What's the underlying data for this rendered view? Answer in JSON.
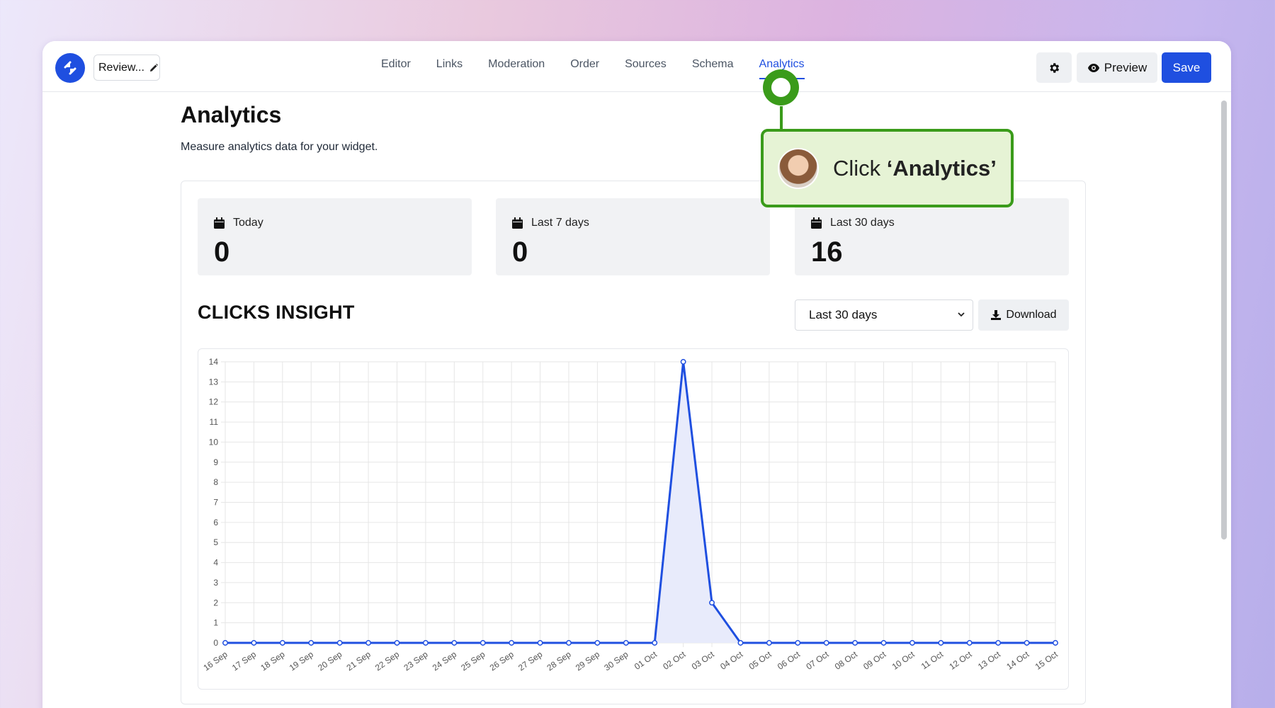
{
  "app": {
    "widget_name": "Review..."
  },
  "nav": {
    "tabs": [
      {
        "label": "Editor"
      },
      {
        "label": "Links"
      },
      {
        "label": "Moderation"
      },
      {
        "label": "Order"
      },
      {
        "label": "Sources"
      },
      {
        "label": "Schema"
      },
      {
        "label": "Analytics"
      }
    ],
    "active_tab": "Analytics"
  },
  "toolbar": {
    "preview_label": "Preview",
    "save_label": "Save"
  },
  "page": {
    "title": "Analytics",
    "subtitle": "Measure analytics data for your widget."
  },
  "stats": [
    {
      "label": "Today",
      "value": "0"
    },
    {
      "label": "Last 7 days",
      "value": "0"
    },
    {
      "label": "Last 30 days",
      "value": "16"
    }
  ],
  "clicks": {
    "title": "CLICKS INSIGHT",
    "range_selected": "Last 30 days",
    "download_label": "Download"
  },
  "tooltip": {
    "prefix": "Click ",
    "target": "‘Analytics’"
  },
  "colors": {
    "accent": "#1f4fe0",
    "tooltip_border": "#3a9b1a",
    "tooltip_bg": "#e6f3d5",
    "area_fill": "#e8ebfb"
  },
  "chart_data": {
    "type": "line",
    "categories": [
      "16 Sep",
      "17 Sep",
      "18 Sep",
      "19 Sep",
      "20 Sep",
      "21 Sep",
      "22 Sep",
      "23 Sep",
      "24 Sep",
      "25 Sep",
      "26 Sep",
      "27 Sep",
      "28 Sep",
      "29 Sep",
      "30 Sep",
      "01 Oct",
      "02 Oct",
      "03 Oct",
      "04 Oct",
      "05 Oct",
      "06 Oct",
      "07 Oct",
      "08 Oct",
      "09 Oct",
      "10 Oct",
      "11 Oct",
      "12 Oct",
      "13 Oct",
      "14 Oct",
      "15 Oct"
    ],
    "values": [
      0,
      0,
      0,
      0,
      0,
      0,
      0,
      0,
      0,
      0,
      0,
      0,
      0,
      0,
      0,
      0,
      14,
      2,
      0,
      0,
      0,
      0,
      0,
      0,
      0,
      0,
      0,
      0,
      0,
      0
    ],
    "ylim": [
      0,
      14
    ],
    "yticks": [
      0,
      1,
      2,
      3,
      4,
      5,
      6,
      7,
      8,
      9,
      10,
      11,
      12,
      13,
      14
    ],
    "grid": true,
    "fill": true
  }
}
